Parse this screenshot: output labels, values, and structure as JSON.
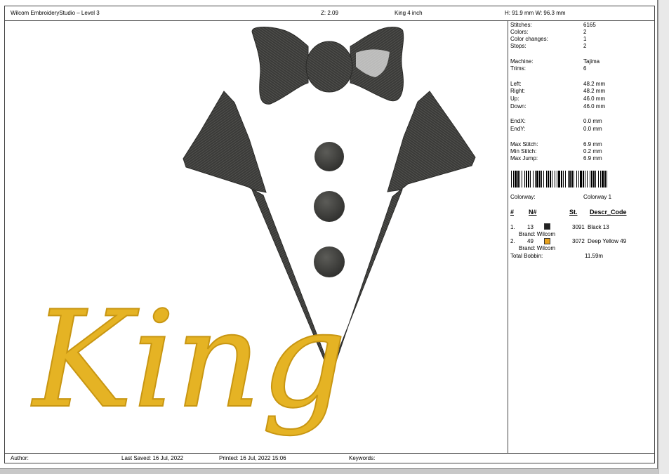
{
  "header": {
    "app_title": "Wilcom EmbroideryStudio – Level 3",
    "zoom": "Z: 2.09",
    "design_name": "King 4 inch",
    "size": "H: 91.9 mm   W: 96.3 mm"
  },
  "stats": {
    "stitches_label": "Stitches:",
    "stitches": "6165",
    "colors_label": "Colors:",
    "colors": "2",
    "color_changes_label": "Color changes:",
    "color_changes": "1",
    "stops_label": "Stops:",
    "stops": "2",
    "machine_label": "Machine:",
    "machine": "Tajima",
    "trims_label": "Trims:",
    "trims": "6",
    "left_label": "Left:",
    "left": "48.2 mm",
    "right_label": "Right:",
    "right": "48.2 mm",
    "up_label": "Up:",
    "up": "46.0 mm",
    "down_label": "Down:",
    "down": "46.0 mm",
    "endx_label": "EndX:",
    "endx": "0.0 mm",
    "endy_label": "EndY:",
    "endy": "0.0 mm",
    "max_stitch_label": "Max Stitch:",
    "max_stitch": "6.9 mm",
    "min_stitch_label": "Min Stitch:",
    "min_stitch": "0.2 mm",
    "max_jump_label": "Max Jump:",
    "max_jump": "6.9 mm"
  },
  "colorway": {
    "label": "Colorway:",
    "value": "Colorway 1"
  },
  "color_table": {
    "headers": [
      "#",
      "N#",
      "St.",
      "Descr_Code"
    ],
    "rows": [
      {
        "index": "1.",
        "n": "13",
        "swatch": "#222222",
        "st": "3091",
        "descr": "Black 13",
        "brand": "Brand: Wilcom"
      },
      {
        "index": "2.",
        "n": "49",
        "swatch": "#e8a21e",
        "st": "3072",
        "descr": "Deep Yellow 49",
        "brand": "Brand: Wilcom"
      }
    ],
    "bobbin_label": "Total Bobbin:",
    "bobbin_value": "11.59m"
  },
  "footer": {
    "author": "Author:",
    "last_saved": "Last Saved:  16 Jul, 2022",
    "printed": "Printed:  16 Jul, 2022 15:06",
    "keywords": "Keywords:"
  },
  "design": {
    "text": "King",
    "thread_black": "#3a3a38",
    "thread_gold": "#e5b324"
  }
}
